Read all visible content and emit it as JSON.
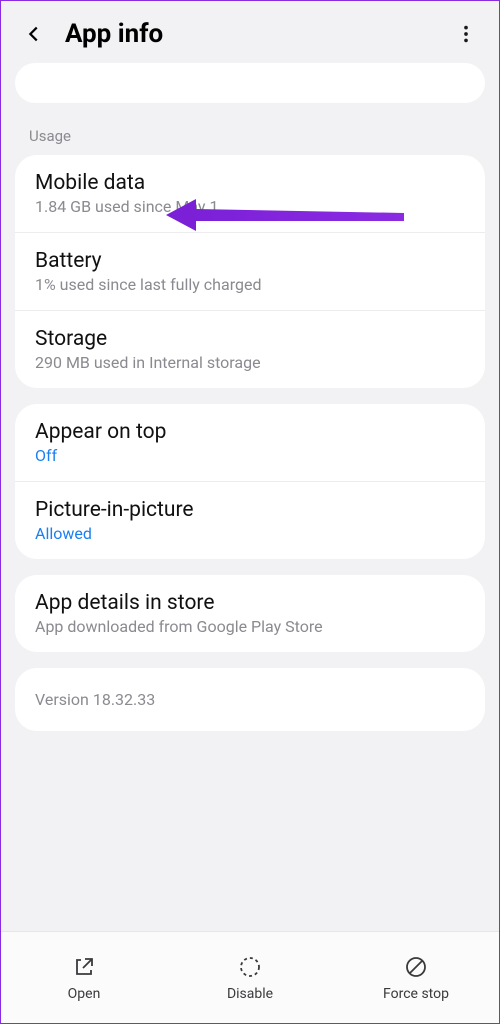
{
  "header": {
    "title": "App info"
  },
  "usage_label": "Usage",
  "usage": {
    "mobile": {
      "title": "Mobile data",
      "sub": "1.84 GB used since May 1"
    },
    "battery": {
      "title": "Battery",
      "sub": "1% used since last fully charged"
    },
    "storage": {
      "title": "Storage",
      "sub": "290 MB used in Internal storage"
    }
  },
  "overlay": {
    "appear": {
      "title": "Appear on top",
      "value": "Off"
    },
    "pip": {
      "title": "Picture-in-picture",
      "value": "Allowed"
    }
  },
  "store": {
    "title": "App details in store",
    "sub": "App downloaded from Google Play Store"
  },
  "version": "Version 18.32.33",
  "bottom": {
    "open": "Open",
    "disable": "Disable",
    "forcestop": "Force stop"
  }
}
